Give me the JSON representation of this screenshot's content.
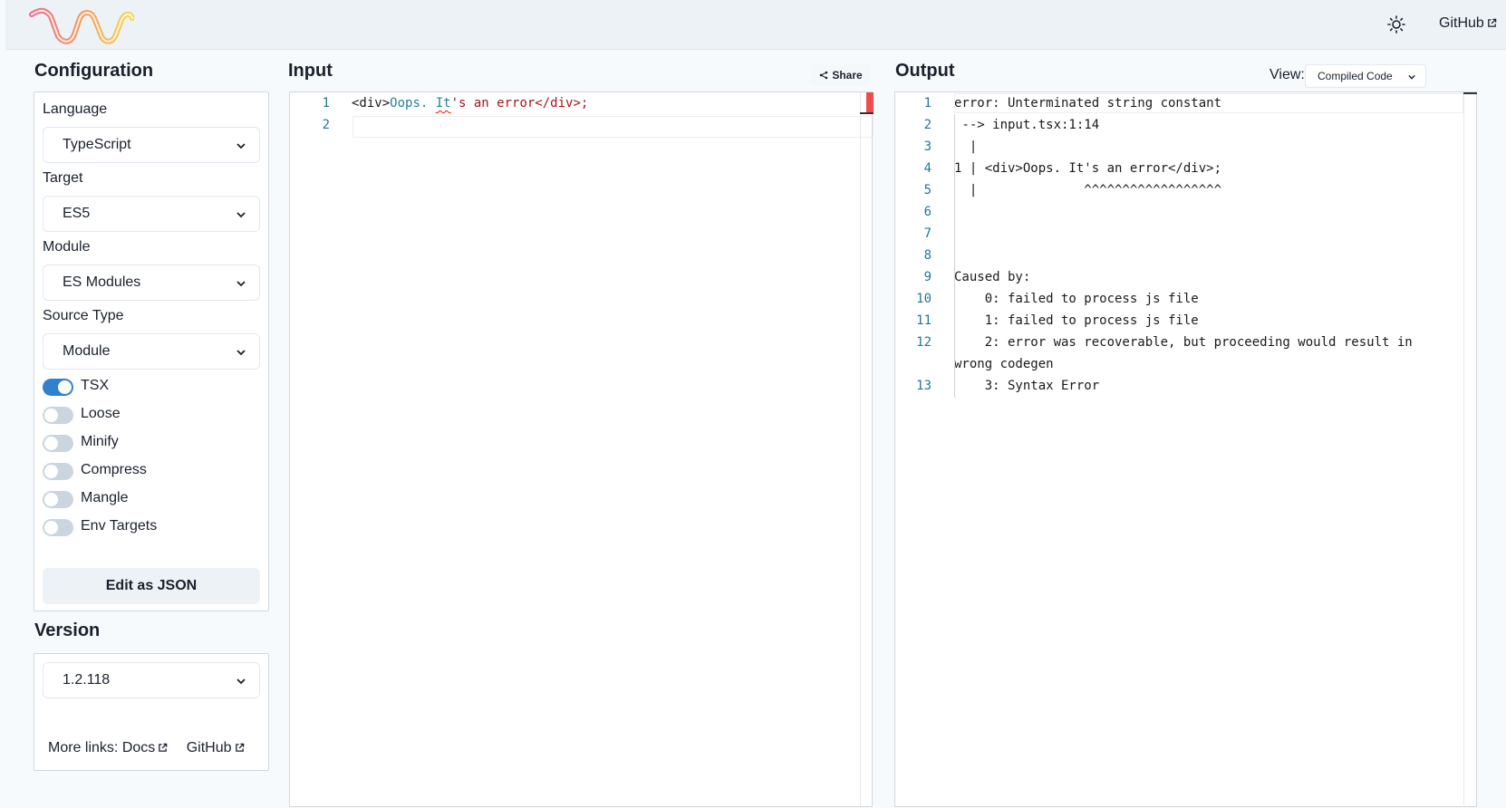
{
  "header": {
    "logo_name": "swc-logo",
    "theme_icon": "sun-icon",
    "github_label": "GitHub",
    "github_icon": "external-link-icon",
    "logo_colors": [
      "#f8c54a",
      "#f39a5e",
      "#f06a8c"
    ]
  },
  "config": {
    "title": "Configuration",
    "language": {
      "label": "Language",
      "value": "TypeScript"
    },
    "target": {
      "label": "Target",
      "value": "ES5"
    },
    "module": {
      "label": "Module",
      "value": "ES Modules"
    },
    "source_type": {
      "label": "Source Type",
      "value": "Module"
    },
    "toggles": [
      {
        "label": "TSX",
        "on": true
      },
      {
        "label": "Loose",
        "on": false
      },
      {
        "label": "Minify",
        "on": false
      },
      {
        "label": "Compress",
        "on": false
      },
      {
        "label": "Mangle",
        "on": false
      },
      {
        "label": "Env Targets",
        "on": false
      }
    ],
    "edit_json_label": "Edit as JSON"
  },
  "version": {
    "title": "Version",
    "value": "1.2.118",
    "more_links_label": "More links:",
    "docs_label": "Docs",
    "github_label": "GitHub"
  },
  "input": {
    "title": "Input",
    "share_label": "Share",
    "share_icon": "share-icon",
    "line_numbers": [
      "1",
      "2"
    ],
    "line1": {
      "tag_open": "<div>",
      "text": "Oops. ",
      "squiggle": "It",
      "str": "'s an error</div>;"
    }
  },
  "output": {
    "title": "Output",
    "view_label": "View:",
    "view_value": "Compiled Code",
    "lines": [
      {
        "n": "1",
        "text": "error: Unterminated string constant"
      },
      {
        "n": "2",
        "text": " --> input.tsx:1:14"
      },
      {
        "n": "3",
        "text": "  |"
      },
      {
        "n": "4",
        "text": "1 | <div>Oops. It's an error</div>;"
      },
      {
        "n": "5",
        "text": "  |              ^^^^^^^^^^^^^^^^^^"
      },
      {
        "n": "6",
        "text": ""
      },
      {
        "n": "7",
        "text": ""
      },
      {
        "n": "8",
        "text": ""
      },
      {
        "n": "9",
        "text": "Caused by:"
      },
      {
        "n": "10",
        "text": "    0: failed to process js file"
      },
      {
        "n": "11",
        "text": "    1: failed to process js file"
      },
      {
        "n": "12",
        "text": "    2: error was recoverable, but proceeding would result in"
      },
      {
        "n": "",
        "text": "wrong codegen"
      },
      {
        "n": "13",
        "text": "    3: Syntax Error"
      }
    ]
  }
}
